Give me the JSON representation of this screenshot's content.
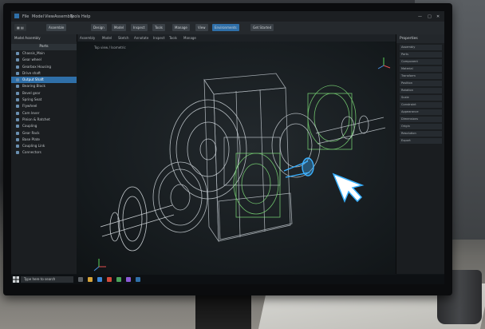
{
  "app": {
    "menu": [
      "File",
      "Model",
      "View",
      "Assembly",
      "Tools",
      "Help"
    ],
    "ribbon_tabs": [
      "Assemble",
      "Design",
      "Model",
      "Inspect",
      "Tools",
      "Manage",
      "View",
      "Environments",
      "Get Started"
    ],
    "subbar_tabs": [
      "Assembly",
      "Model",
      "Sketch",
      "Annotate",
      "Inspect",
      "Tools",
      "Manage"
    ],
    "viewport_label": "Top view / Isometric"
  },
  "left_panel": {
    "tabs": "Model  Assembly",
    "title": "Parts",
    "items": [
      {
        "label": "Chassis_Main",
        "selected": false
      },
      {
        "label": "Gear wheel",
        "selected": false
      },
      {
        "label": "Gearbox Housing",
        "selected": false
      },
      {
        "label": "Drive shaft",
        "selected": false
      },
      {
        "label": "Output Shaft",
        "selected": true
      },
      {
        "label": "Bearing Block",
        "selected": false
      },
      {
        "label": "Bevel gear",
        "selected": false
      },
      {
        "label": "Spring Seat",
        "selected": false
      },
      {
        "label": "Flywheel",
        "selected": false
      },
      {
        "label": "Cam lever",
        "selected": false
      },
      {
        "label": "Pinion & Ratchet",
        "selected": false
      },
      {
        "label": "Coupling",
        "selected": false
      },
      {
        "label": "Gear Rack",
        "selected": false
      },
      {
        "label": "Base Plate",
        "selected": false
      },
      {
        "label": "Coupling Link",
        "selected": false
      },
      {
        "label": "Connectors",
        "selected": false
      }
    ]
  },
  "right_panel": {
    "title": "Properties",
    "lines": [
      "Assembly",
      "Parts",
      "Component",
      "Material",
      "Transform",
      "Position",
      "Rotation",
      "Scale",
      "Constraint",
      "Appearance",
      "Dimensions",
      "Origin",
      "Resolution",
      "Export"
    ]
  },
  "taskbar": {
    "search_placeholder": "Type here to search"
  },
  "colors": {
    "accent": "#2f6fa8",
    "wire": "#cfd6dc",
    "wire_green": "#7fe07a",
    "highlight": "#3ab0ff"
  }
}
